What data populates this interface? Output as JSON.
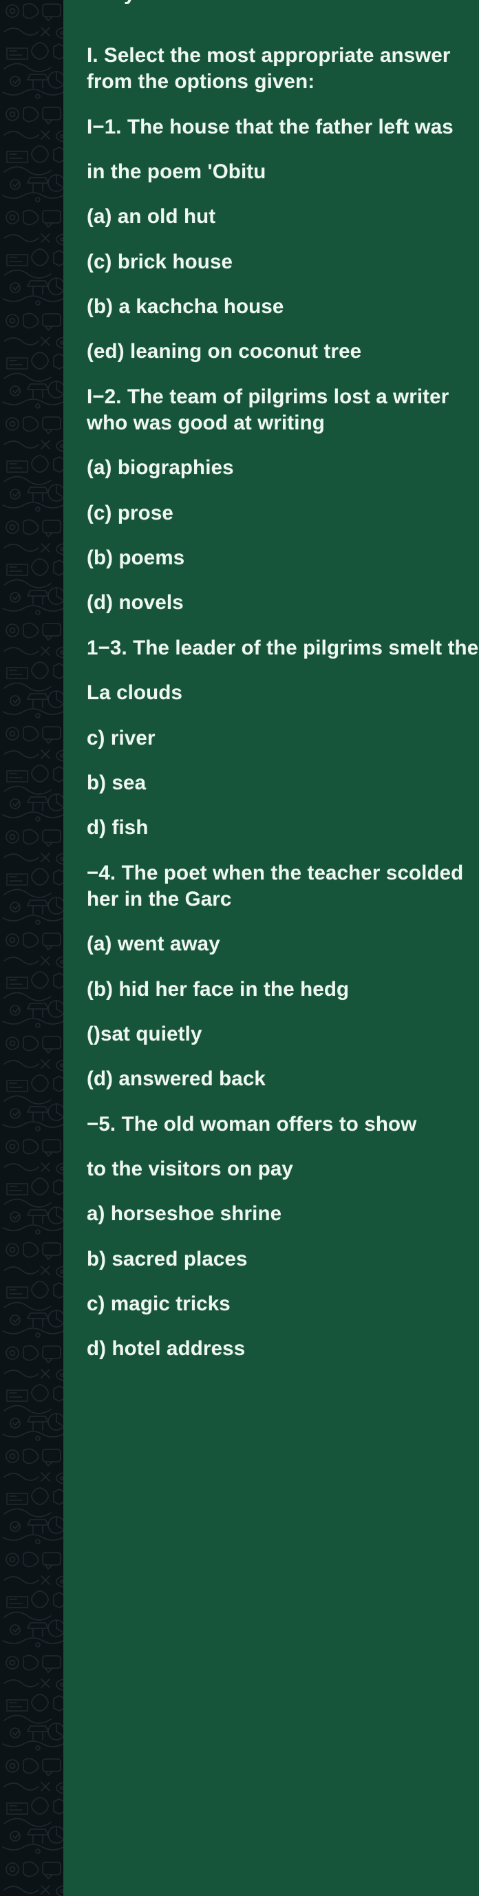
{
  "app": {
    "name": "whatsapp-chat",
    "theme": "dark",
    "wallpaper": "doodle-pattern"
  },
  "colors": {
    "wallpaper_background": "#0c1317",
    "doodle_stroke": "#243239",
    "bubble_outgoing": "#17553b",
    "bubble_text": "#eef7f1"
  },
  "message": {
    "direction": "outgoing",
    "clipped_top_fragment": "y",
    "lines": [
      "I. Select the most appropriate answer from the options given:",
      "I−1. The house that the father left was",
      "in the poem 'Obitu",
      "(a) an old hut",
      "(c) brick house",
      "(b) a kachcha house",
      "(ed) leaning on coconut tree",
      "I−2. The team of pilgrims lost a writer who was good at writing",
      "(a) biographies",
      "(c) prose",
      "(b) poems",
      "(d) novels",
      "1−3. The leader of the pilgrims smelt the",
      "La clouds",
      "c) river",
      "b) sea",
      "d) fish",
      "−4. The poet when the teacher scolded her in the Garc",
      "(a) went away",
      "(b) hid her face in the hedg",
      "()sat quietly",
      "(d) answered back",
      "−5. The old woman offers to show",
      "to the visitors on pay",
      "a) horseshoe shrine",
      "b) sacred places",
      "c) magic tricks",
      "d) hotel address"
    ]
  }
}
